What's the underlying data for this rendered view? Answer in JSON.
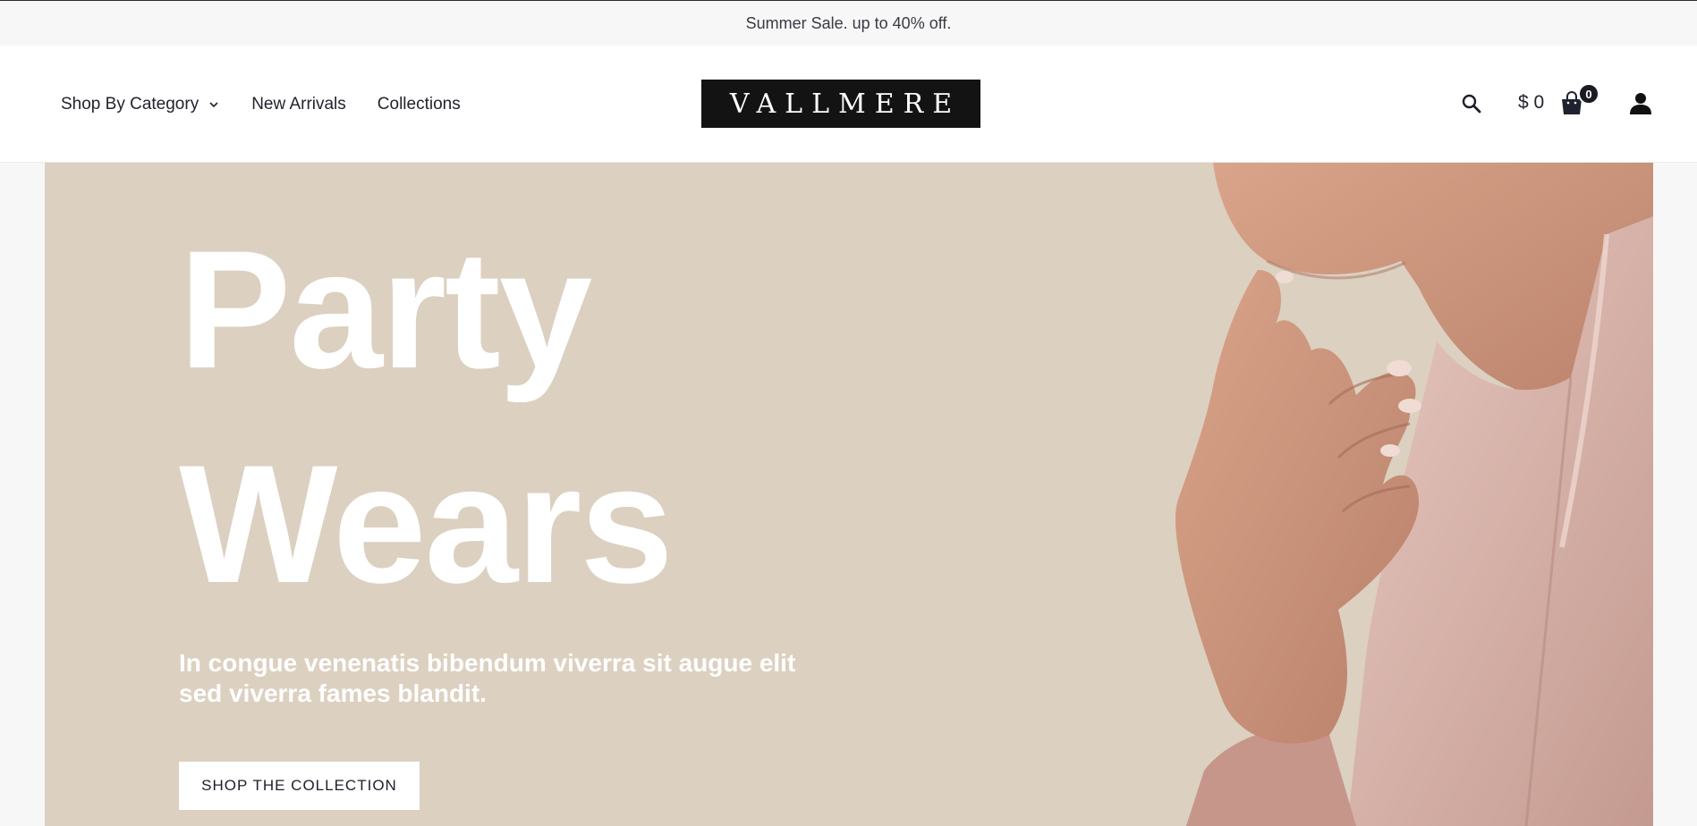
{
  "announcement": {
    "text": "Summer Sale. up to 40% off."
  },
  "header": {
    "nav": [
      {
        "label": "Shop By Category"
      },
      {
        "label": "New Arrivals"
      },
      {
        "label": "Collections"
      }
    ],
    "logo_text": "VALLMERE",
    "price": "$ 0",
    "cart_count": "0",
    "icons": [
      "search-icon",
      "cart-icon",
      "account-icon",
      "chevron-down-icon"
    ]
  },
  "hero": {
    "title_line1": "Party",
    "title_line2": "Wears",
    "subtitle": "In congue venenatis bibendum viverra sit augue elit sed viverra fames blandit.",
    "cta_label": "SHOP THE COLLECTION",
    "background_color": "#dcd0c0"
  }
}
